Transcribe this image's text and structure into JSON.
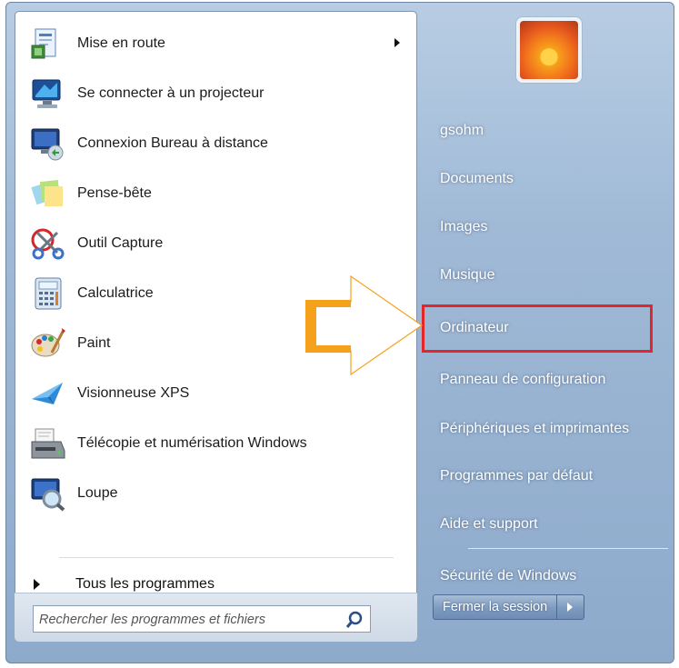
{
  "programs": [
    {
      "label": "Mise en route",
      "icon": "getting-started-icon",
      "has_submenu": true
    },
    {
      "label": "Se connecter à un projecteur",
      "icon": "projector-icon",
      "has_submenu": false
    },
    {
      "label": "Connexion Bureau à distance",
      "icon": "remote-desktop-icon",
      "has_submenu": false
    },
    {
      "label": "Pense-bête",
      "icon": "sticky-notes-icon",
      "has_submenu": false
    },
    {
      "label": "Outil Capture",
      "icon": "snipping-tool-icon",
      "has_submenu": false
    },
    {
      "label": "Calculatrice",
      "icon": "calculator-icon",
      "has_submenu": false
    },
    {
      "label": "Paint",
      "icon": "paint-palette-icon",
      "has_submenu": false
    },
    {
      "label": "Visionneuse XPS",
      "icon": "xps-viewer-icon",
      "has_submenu": false
    },
    {
      "label": "Télécopie et numérisation Windows",
      "icon": "fax-scan-icon",
      "has_submenu": false
    },
    {
      "label": "Loupe",
      "icon": "magnifier-icon",
      "has_submenu": false
    }
  ],
  "all_programs_label": "Tous les programmes",
  "search": {
    "placeholder": "Rechercher les programmes et fichiers"
  },
  "user": {
    "name": "gsohm"
  },
  "right_items": [
    {
      "label": "gsohm"
    },
    {
      "label": "Documents"
    },
    {
      "label": "Images"
    },
    {
      "label": "Musique"
    },
    {
      "label": "Ordinateur",
      "highlighted": true
    },
    {
      "label": "Panneau de configuration"
    },
    {
      "label": "Périphériques et imprimantes"
    },
    {
      "label": "Programmes par défaut"
    },
    {
      "label": "Aide et support"
    },
    {
      "label": "Sécurité de Windows"
    }
  ],
  "shutdown": {
    "label": "Fermer la session"
  },
  "colors": {
    "highlight_box": "#e4262b",
    "callout_arrow": "#f5a11c"
  }
}
